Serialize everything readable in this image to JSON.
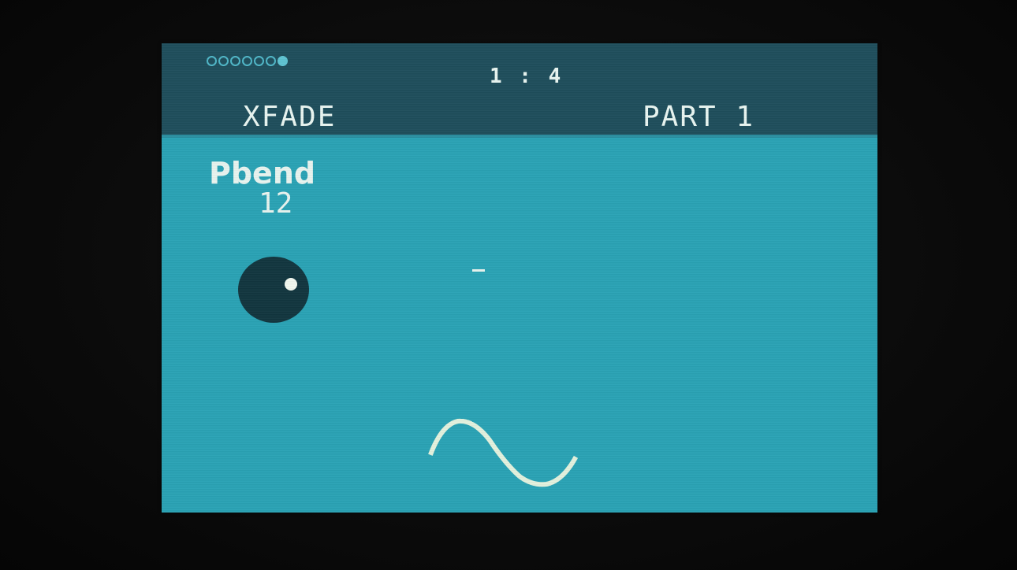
{
  "header": {
    "page_indicator": {
      "total": 7,
      "active_index": 6
    },
    "position": "1 : 4",
    "mode_title": "XFADE",
    "part_label": "PART 1"
  },
  "main": {
    "parameter": {
      "name": "Pbend",
      "value": "12"
    },
    "marker": "–",
    "waveform": "sine-wave"
  },
  "colors": {
    "screen_background": "#2aa3b5",
    "header_background": "#1f4e5c",
    "text": "#e9f6f2",
    "knob": "#12363f",
    "page_dot": "#5fc4d3"
  }
}
